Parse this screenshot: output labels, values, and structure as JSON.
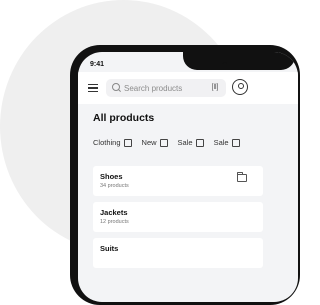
{
  "status_bar": {
    "time": "9:41"
  },
  "header": {
    "search_placeholder": "Search products"
  },
  "page_title": "All products",
  "filters": [
    {
      "label": "Clothing"
    },
    {
      "label": "New"
    },
    {
      "label": "Sale"
    },
    {
      "label": "Sale"
    }
  ],
  "products": [
    {
      "name": "Shoes",
      "count": "34 products"
    },
    {
      "name": "Jackets",
      "count": "12 products"
    },
    {
      "name": "Suits",
      "count": ""
    }
  ],
  "icons": [
    "menu-icon",
    "search-icon",
    "barcode-scan-icon",
    "account-icon",
    "folder-icon",
    "signal-icon",
    "wifi-icon"
  ]
}
